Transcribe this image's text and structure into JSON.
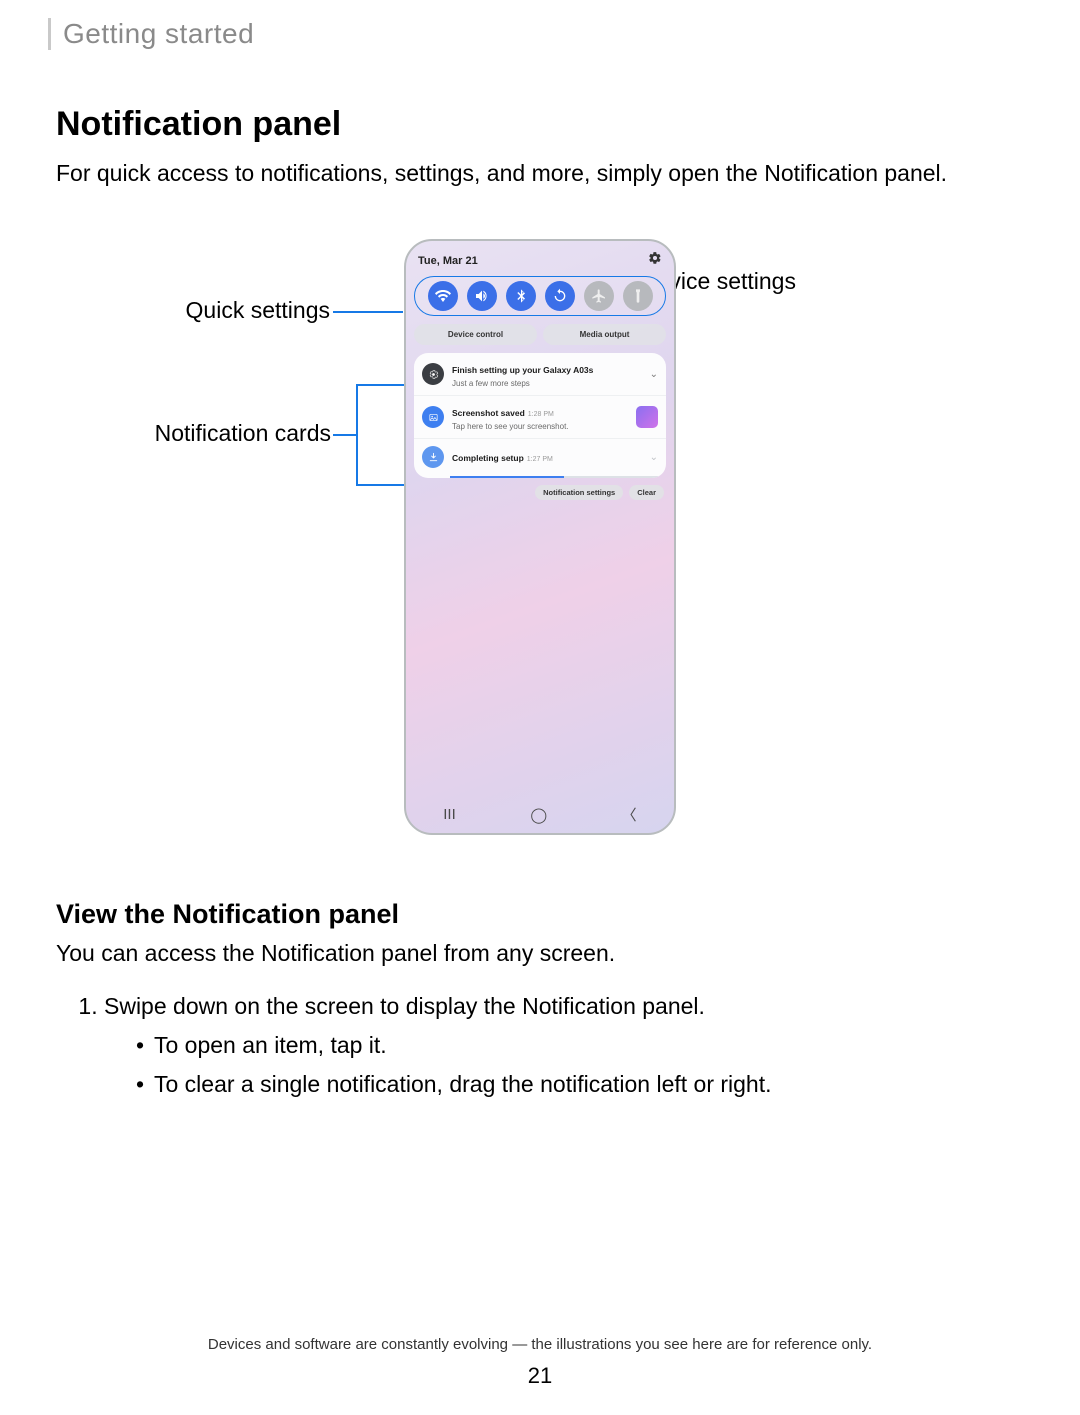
{
  "crumb": "Getting started",
  "title": "Notification panel",
  "intro": "For quick access to notifications, settings, and more, simply open the Notification panel.",
  "labels": {
    "device_settings": "Device settings",
    "quick_settings": "Quick settings",
    "notification_cards": "Notification cards"
  },
  "phone": {
    "date": "Tue, Mar 21",
    "pills": {
      "device_control": "Device control",
      "media_output": "Media output"
    },
    "cards": [
      {
        "title": "Finish setting up your Galaxy A03s",
        "sub": "Just a few more steps"
      },
      {
        "title": "Screenshot saved",
        "time": "1:28 PM",
        "sub": "Tap here to see your screenshot."
      },
      {
        "title": "Completing setup",
        "time": "1:27 PM"
      }
    ],
    "actions": {
      "settings": "Notification settings",
      "clear": "Clear"
    }
  },
  "section2": {
    "heading": "View the Notification panel",
    "intro": "You can access the Notification panel from any screen.",
    "step1": "Swipe down on the screen to display the Notification panel.",
    "bullets": [
      "To open an item, tap it.",
      "To clear a single notification, drag the notification left or right."
    ]
  },
  "footer": "Devices and software are constantly evolving — the illustrations you see here are for reference only.",
  "page": "21"
}
